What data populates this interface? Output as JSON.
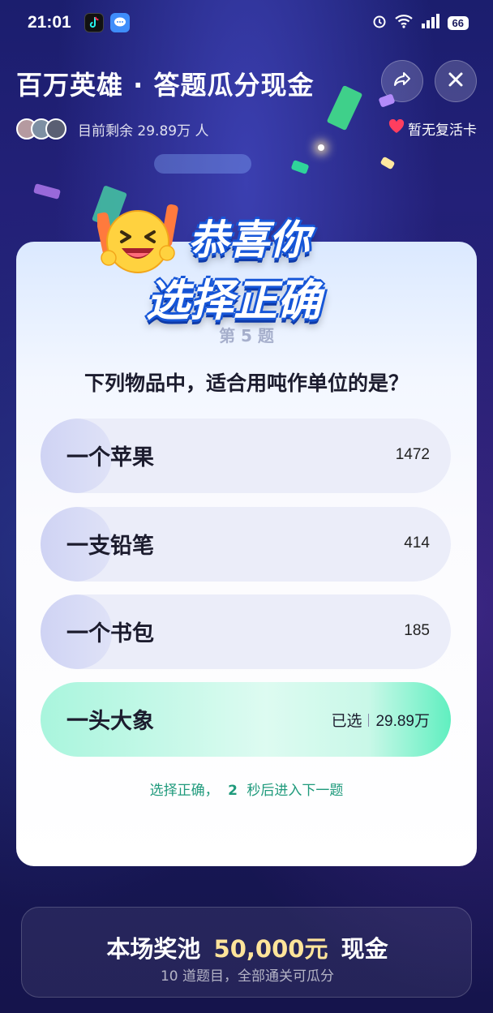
{
  "status_bar": {
    "time": "21:01",
    "battery": "66"
  },
  "header": {
    "title": "百万英雄 · 答题瓜分现金",
    "remaining": "目前剩余 29.89万 人",
    "revive": "暂无复活卡"
  },
  "banner": {
    "line1": "恭喜你",
    "line2": "选择正确"
  },
  "quiz": {
    "question_number": "第 5 题",
    "question": "下列物品中，适合用吨作单位的是？",
    "options": [
      {
        "label": "一个苹果",
        "count": "1472"
      },
      {
        "label": "一支铅笔",
        "count": "414"
      },
      {
        "label": "一个书包",
        "count": "185"
      },
      {
        "label": "一头大象",
        "selected_tag": "已选",
        "count": "29.89万"
      }
    ],
    "tip_prefix": "选择正确，",
    "tip_seconds": "2",
    "tip_suffix": "秒后进入下一题"
  },
  "prize": {
    "title_prefix": "本场奖池",
    "amount": "50,000元",
    "title_suffix": "现金",
    "subtitle": "10 道题目，全部通关可瓜分"
  },
  "colors": {
    "correct_green": "#1f9a7c",
    "prize_gold": "#ffe49a",
    "banner_blue": "#1656d8"
  }
}
